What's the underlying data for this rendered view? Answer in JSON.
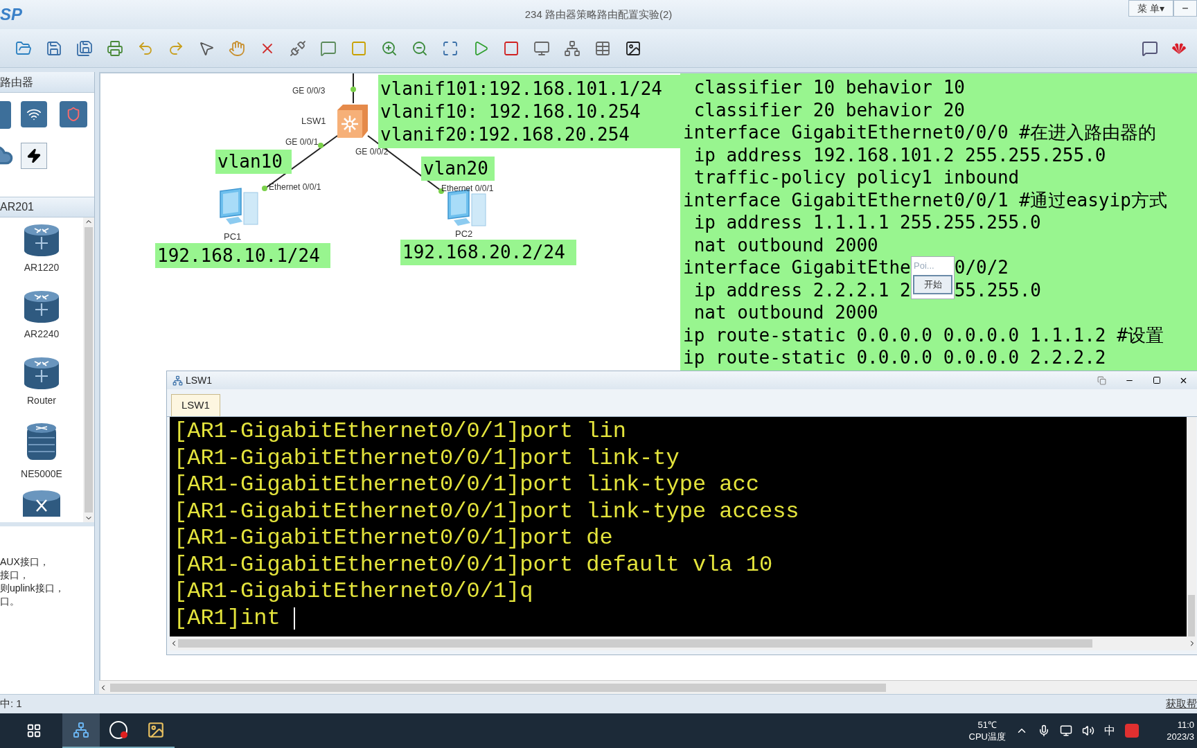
{
  "window": {
    "logo": "SP",
    "title": "234 路由器策略路由配置实验(2)",
    "menu_button": "菜 单▾"
  },
  "device_panel": {
    "category": "路由器",
    "model_header": "AR201",
    "devices": [
      {
        "name": "AR1220",
        "kind": "router"
      },
      {
        "name": "AR2240",
        "kind": "router"
      },
      {
        "name": "Router",
        "kind": "router"
      },
      {
        "name": "NE5000E",
        "kind": "core"
      }
    ],
    "description": [
      "AUX接口，",
      "接口，",
      "则uplink接口，",
      "口。"
    ]
  },
  "topology": {
    "nodes": [
      {
        "label": "LSW1",
        "kind": "switch"
      },
      {
        "label": "PC1",
        "kind": "pc"
      },
      {
        "label": "PC2",
        "kind": "pc"
      }
    ],
    "ports": [
      "GE 0/0/3",
      "GE 0/0/1",
      "GE 0/0/2",
      "Ethernet 0/0/1",
      "Ethernet 0/0/1"
    ],
    "notes": [
      {
        "lines": [
          "vlanif101:192.168.101.1/24",
          "vlanif10: 192.168.10.254",
          "vlanif20:192.168.20.254"
        ]
      },
      {
        "lines": [
          "vlan10"
        ]
      },
      {
        "lines": [
          "vlan20"
        ]
      },
      {
        "lines": [
          "192.168.10.1/24"
        ]
      },
      {
        "lines": [
          "192.168.20.2/24"
        ]
      }
    ]
  },
  "config_text": {
    "lines": [
      {
        "segments": [
          " classifier 10 behavior 10"
        ]
      },
      {
        "segments": [
          " classifier 20 behavior 20"
        ]
      },
      {
        "segments": [
          "interface GigabitEthernet0/0/0 #在进入路由器的"
        ]
      },
      {
        "segments": [
          " ip address 192.168.101.2 255.255.255.0"
        ]
      },
      {
        "segments": [
          " traffic-policy policy1 inbound"
        ]
      },
      {
        "segments": [
          "interface GigabitEthernet0/0/1 #通过easyip方式"
        ]
      },
      {
        "segments": [
          " ip address 1.1.1.1 255.255.255.0"
        ]
      },
      {
        "segments": [
          " nat outbound 2000"
        ]
      },
      {
        "segments": [
          "interface GigabitEthe",
          "0/0/2"
        ]
      },
      {
        "segments": [
          " ip address 2.2.2.1 2",
          "55.255.0"
        ]
      },
      {
        "segments": [
          " nat outbound 2000"
        ]
      },
      {
        "segments": [
          "ip route-static 0.0.0.0 0.0.0.0 1.1.1.2 #设置"
        ]
      },
      {
        "segments": [
          "ip route-static 0.0.0.0 0.0.0.0 2.2.2.2"
        ]
      }
    ],
    "popup": {
      "title": "Poi...",
      "button": "开始"
    }
  },
  "terminal": {
    "title": "LSW1",
    "tabs": [
      {
        "label": "LSW1",
        "selected": true
      }
    ],
    "lines": [
      "[AR1-GigabitEthernet0/0/1]port lin",
      "[AR1-GigabitEthernet0/0/1]port link-ty",
      "[AR1-GigabitEthernet0/0/1]port link-type acc",
      "[AR1-GigabitEthernet0/0/1]port link-type access",
      "[AR1-GigabitEthernet0/0/1]port de",
      "[AR1-GigabitEthernet0/0/1]port default vla 10",
      "[AR1-GigabitEthernet0/0/1]q",
      "[AR1]int "
    ]
  },
  "status_bar": {
    "left": "中: 1",
    "right": "获取帮"
  },
  "taskbar": {
    "temperature": "51℃",
    "temperature_label": "CPU温度",
    "ime": "中",
    "time": "11:0",
    "date": "2023/3"
  }
}
